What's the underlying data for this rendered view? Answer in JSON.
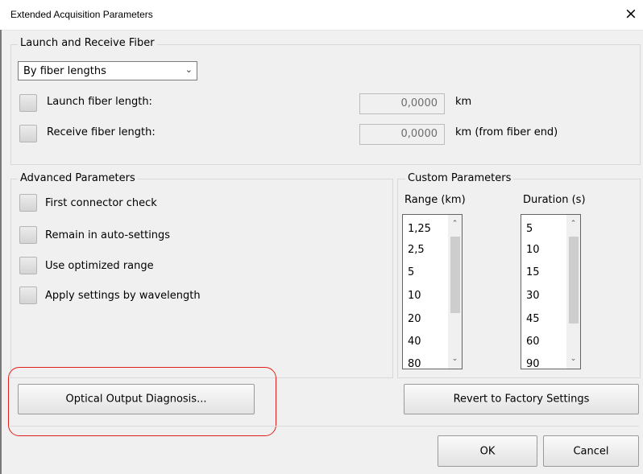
{
  "dialog": {
    "title": "Extended Acquisition Parameters",
    "close_glyph": "×"
  },
  "launch_receive": {
    "legend": "Launch and Receive Fiber",
    "mode_select": "By fiber lengths",
    "launch_label": "Launch fiber length:",
    "launch_value": "0,0000",
    "launch_unit": "km",
    "receive_label": "Receive fiber length:",
    "receive_value": "0,0000",
    "receive_unit": "km (from fiber end)"
  },
  "advanced": {
    "legend": "Advanced Parameters",
    "options": [
      "First connector check",
      "Remain in auto-settings",
      "Use optimized range",
      "Apply settings by wavelength"
    ]
  },
  "custom": {
    "legend": "Custom Parameters",
    "range_header": "Range (km)",
    "range_items": [
      "1,25",
      "2,5",
      "5",
      "10",
      "20",
      "40",
      "80"
    ],
    "duration_header": "Duration (s)",
    "duration_items": [
      "5",
      "10",
      "15",
      "30",
      "45",
      "60",
      "90"
    ]
  },
  "buttons": {
    "optical": "Optical Output Diagnosis...",
    "revert": "Revert to Factory Settings",
    "ok": "OK",
    "cancel": "Cancel"
  },
  "colors": {
    "highlight": "#e0201c",
    "background": "#f0f0f0"
  }
}
